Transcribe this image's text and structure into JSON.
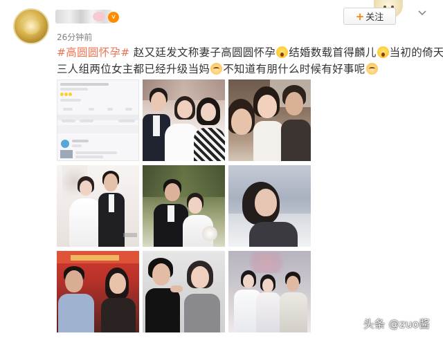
{
  "post": {
    "timestamp": "26分钟前",
    "follow_label": "关注",
    "follow_plus": "+",
    "vip_glyph": "v",
    "text": {
      "hashtag": "#高圆圆怀孕#",
      "part1": " 赵又廷发文称妻子高圆圆怀孕",
      "part2": "结婚数载首得麟儿",
      "part3": "当初的倚天三人组两位女主都已经升级当妈",
      "part4": "不知道有朋什么时候有好事呢"
    },
    "emojis": [
      "shock-emoji",
      "shock-emoji",
      "cat-emoji",
      "cat-emoji"
    ]
  },
  "grid": {
    "photos": [
      "weibo-screenshot-thumbnail",
      "couple-wedding-photo",
      "friends-selfie-photo",
      "bride-groom-photo",
      "wedding-ceremony-photo",
      "portrait-photo",
      "event-photo",
      "two-women-photo",
      "period-drama-photo"
    ]
  },
  "watermark": "头条 @zuo酱",
  "colors": {
    "hashtag": "#eb7350",
    "follow_plus": "#ff8200",
    "text": "#333333",
    "timestamp": "#808080"
  }
}
